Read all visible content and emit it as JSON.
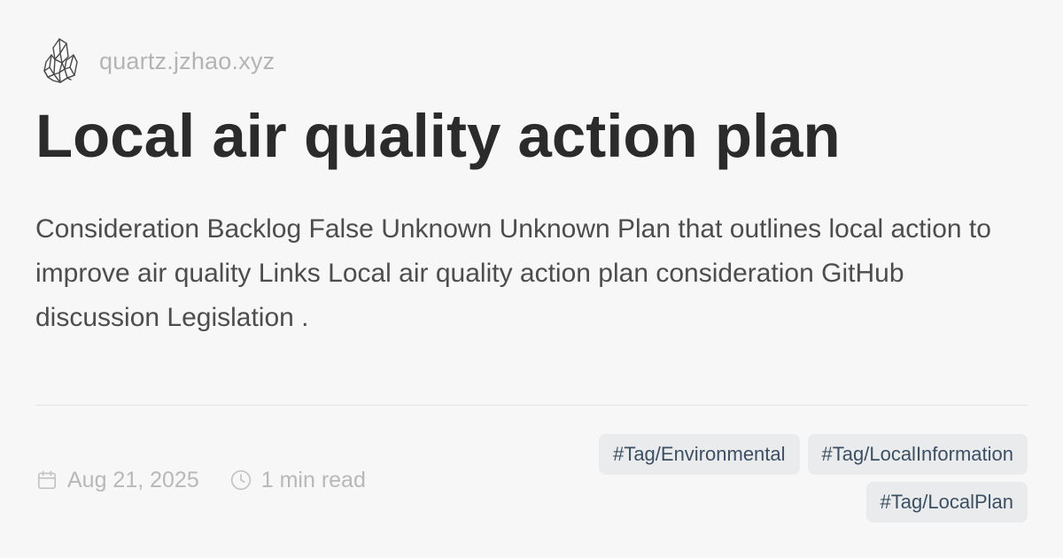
{
  "header": {
    "logo_icon": "crystal-logo-icon",
    "site_name": "quartz.jzhao.xyz"
  },
  "page": {
    "title": "Local air quality action plan",
    "description": "Consideration Backlog False Unknown Unknown Plan that outlines local action to improve air quality Links Local air quality action plan consideration GitHub discussion Legislation ."
  },
  "meta": {
    "date_icon": "calendar-icon",
    "date": "Aug 21, 2025",
    "reading_time_icon": "clock-icon",
    "reading_time": "1 min read"
  },
  "tags": [
    {
      "label": "#Tag/Environmental"
    },
    {
      "label": "#Tag/LocalInformation"
    },
    {
      "label": "#Tag/LocalPlan"
    }
  ],
  "colors": {
    "background": "#f7f7f7",
    "title": "#2b2b2b",
    "description": "#4d4d4d",
    "muted": "#b4b4b4",
    "tag_background": "#e9ebed",
    "tag_text": "#3d4f63",
    "divider": "#e3e3e3"
  }
}
